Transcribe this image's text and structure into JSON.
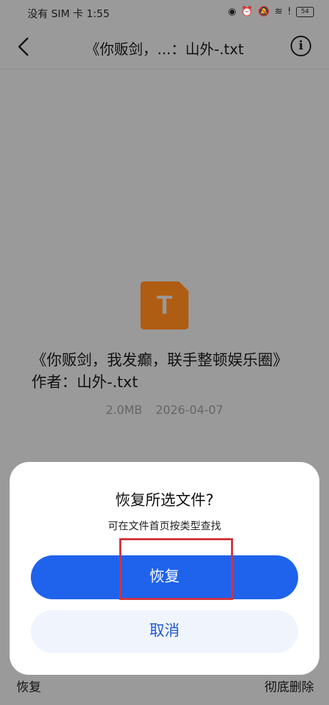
{
  "status_bar": {
    "carrier": "没有 SIM 卡 1:55",
    "battery": "54"
  },
  "header": {
    "title": "《你贩剑，...：山外-.txt"
  },
  "file": {
    "icon_letter": "T",
    "name": "《你贩剑，我发癫，联手整顿娱乐圈》作者：山外-.txt",
    "size": "2.0MB",
    "date": "2026-04-07"
  },
  "bottom_bar": {
    "restore_label": "恢复",
    "delete_label": "彻底删除"
  },
  "dialog": {
    "title": "恢复所选文件?",
    "subtitle": "可在文件首页按类型查找",
    "confirm_label": "恢复",
    "cancel_label": "取消"
  },
  "colors": {
    "accent": "#1f63ec",
    "file_icon": "#b05d14",
    "highlight": "#d2333d"
  }
}
